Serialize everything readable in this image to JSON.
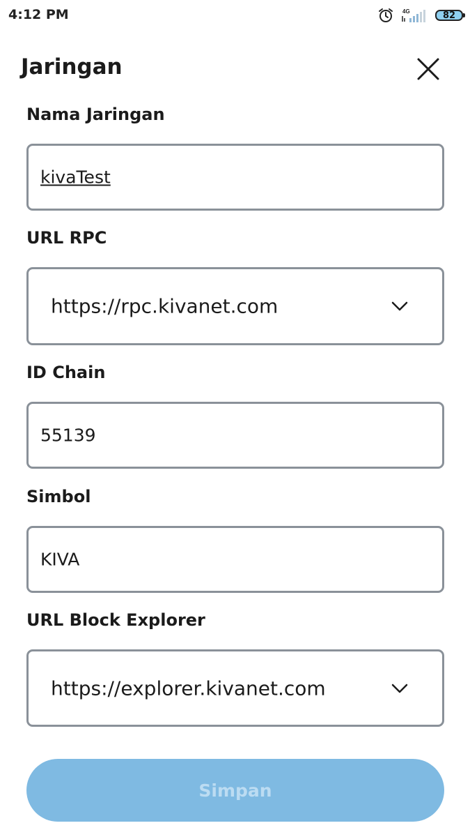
{
  "status_bar": {
    "time": "4:12 PM",
    "network": "4G",
    "battery": "82",
    "icons": [
      "alarm-icon",
      "signal-icon",
      "battery-icon"
    ]
  },
  "header": {
    "title": "Jaringan",
    "close_icon": "close-icon"
  },
  "form": {
    "network_name": {
      "label": "Nama Jaringan",
      "value": "kivaTest"
    },
    "rpc_url": {
      "label": "URL RPC",
      "value": "https://rpc.kivanet.com",
      "icon": "chevron-down-icon"
    },
    "chain_id": {
      "label": "ID Chain",
      "value": "55139"
    },
    "symbol": {
      "label": "Simbol",
      "value": "KIVA"
    },
    "explorer_url": {
      "label": "URL Block Explorer",
      "value": "https://explorer.kivanet.com",
      "icon": "chevron-down-icon"
    }
  },
  "actions": {
    "save_label": "Simpan"
  },
  "colors": {
    "field_border": "#8a9199",
    "button_bg": "#7fbae2",
    "button_text": "#bcdcf2",
    "battery_fill": "#8fd0f0"
  }
}
